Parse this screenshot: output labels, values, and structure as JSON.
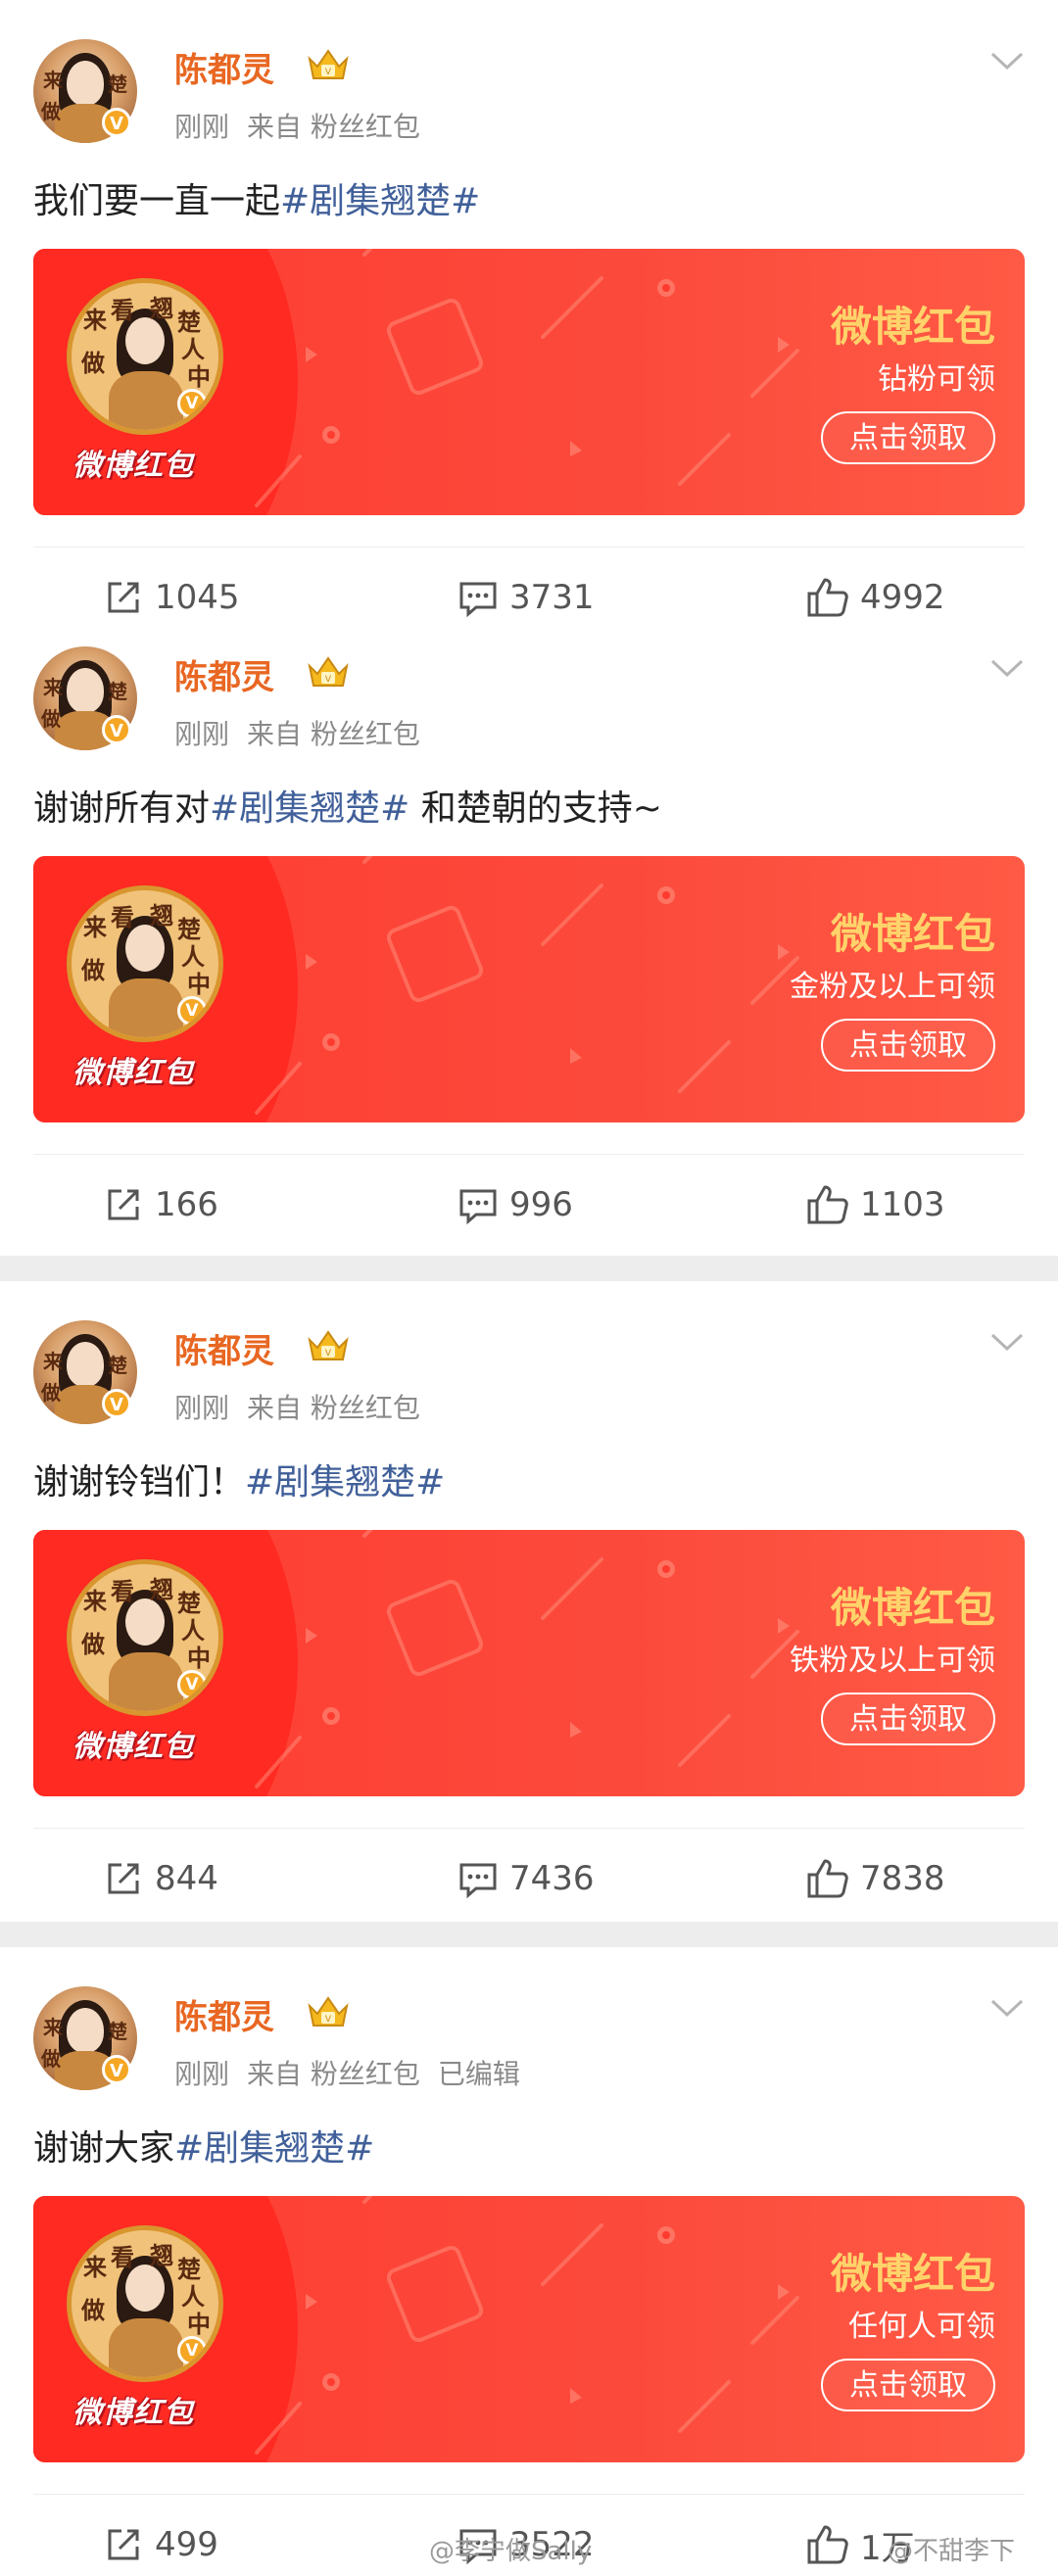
{
  "posts": [
    {
      "username": "陈都灵",
      "meta_time": "刚刚",
      "meta_from": "来自 粉丝红包",
      "edited": "",
      "text_prefix": "我们要一直一起",
      "hashtag": "#剧集翘楚#",
      "text_suffix": "",
      "card": {
        "brand": "微博红包",
        "title": "微博红包",
        "subtitle": "钻粉可领",
        "button": "点击领取"
      },
      "repost_count": "1045",
      "comment_count": "3731",
      "like_count": "4992"
    },
    {
      "username": "陈都灵",
      "meta_time": "刚刚",
      "meta_from": "来自 粉丝红包",
      "edited": "",
      "text_prefix": "谢谢所有对",
      "hashtag": "#剧集翘楚#",
      "text_suffix": " 和楚朝的支持~",
      "card": {
        "brand": "微博红包",
        "title": "微博红包",
        "subtitle": "金粉及以上可领",
        "button": "点击领取"
      },
      "repost_count": "166",
      "comment_count": "996",
      "like_count": "1103"
    },
    {
      "username": "陈都灵",
      "meta_time": "刚刚",
      "meta_from": "来自 粉丝红包",
      "edited": "",
      "text_prefix": "谢谢铃铛们！",
      "hashtag": "#剧集翘楚#",
      "text_suffix": "",
      "card": {
        "brand": "微博红包",
        "title": "微博红包",
        "subtitle": "铁粉及以上可领",
        "button": "点击领取"
      },
      "repost_count": "844",
      "comment_count": "7436",
      "like_count": "7838"
    },
    {
      "username": "陈都灵",
      "meta_time": "刚刚",
      "meta_from": "来自 粉丝红包",
      "edited": "已编辑",
      "text_prefix": "谢谢大家",
      "hashtag": "#剧集翘楚#",
      "text_suffix": "",
      "card": {
        "brand": "微博红包",
        "title": "微博红包",
        "subtitle": "任何人可领",
        "button": "点击领取"
      },
      "repost_count": "499",
      "comment_count": "3522",
      "like_count": "1万"
    }
  ],
  "watermarks": {
    "left": "@李宁做Sally",
    "right": "@不甜李下"
  },
  "colors": {
    "username": "#e86722",
    "hashtag": "#41609a",
    "card_red": "#ff3b30",
    "card_title": "#ffd36a"
  }
}
